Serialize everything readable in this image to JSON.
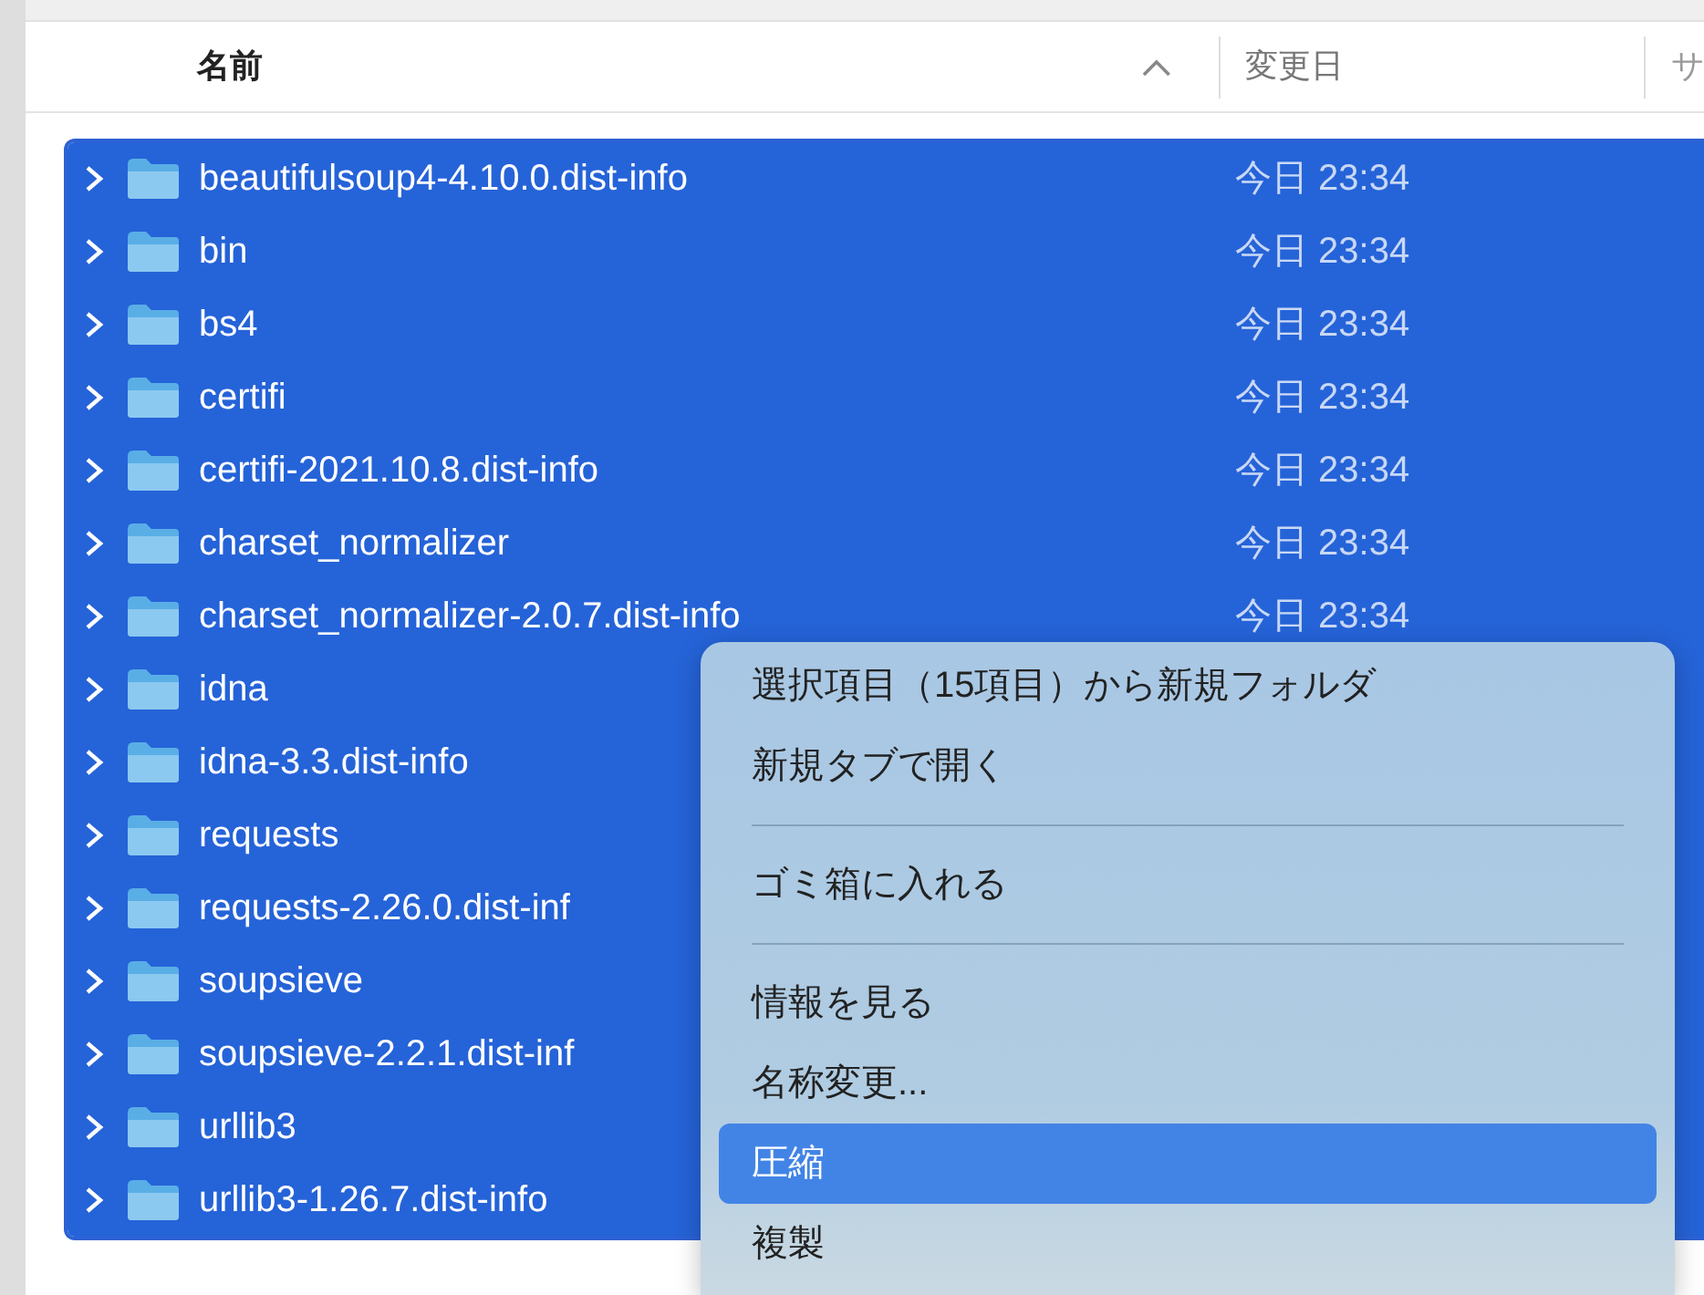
{
  "header": {
    "columns": [
      {
        "label": "名前",
        "sorted": true
      },
      {
        "label": "変更日",
        "sorted": false
      },
      {
        "label": "サ",
        "sorted": false
      }
    ]
  },
  "rows": [
    {
      "name": "beautifulsoup4-4.10.0.dist-info",
      "modified": "今日 23:34",
      "selected": true
    },
    {
      "name": "bin",
      "modified": "今日 23:34",
      "selected": true
    },
    {
      "name": "bs4",
      "modified": "今日 23:34",
      "selected": true
    },
    {
      "name": "certifi",
      "modified": "今日 23:34",
      "selected": true
    },
    {
      "name": "certifi-2021.10.8.dist-info",
      "modified": "今日 23:34",
      "selected": true
    },
    {
      "name": "charset_normalizer",
      "modified": "今日 23:34",
      "selected": true
    },
    {
      "name": "charset_normalizer-2.0.7.dist-info",
      "modified": "今日 23:34",
      "selected": true
    },
    {
      "name": "idna",
      "selected": true
    },
    {
      "name": "idna-3.3.dist-info",
      "selected": true
    },
    {
      "name": "requests",
      "selected": true
    },
    {
      "name": "requests-2.26.0.dist-inf",
      "selected": true
    },
    {
      "name": "soupsieve",
      "selected": true
    },
    {
      "name": "soupsieve-2.2.1.dist-inf",
      "selected": true
    },
    {
      "name": "urllib3",
      "selected": true
    },
    {
      "name": "urllib3-1.26.7.dist-info",
      "selected": true
    }
  ],
  "context_menu": {
    "items": [
      {
        "kind": "item",
        "label": "選択項目（15項目）から新規フォルダ",
        "highlighted": false
      },
      {
        "kind": "item",
        "label": "新規タブで開く",
        "highlighted": false
      },
      {
        "kind": "separator"
      },
      {
        "kind": "item",
        "label": "ゴミ箱に入れる",
        "highlighted": false
      },
      {
        "kind": "separator"
      },
      {
        "kind": "item",
        "label": "情報を見る",
        "highlighted": false
      },
      {
        "kind": "item",
        "label": "名称変更...",
        "highlighted": false
      },
      {
        "kind": "item",
        "label": "圧縮",
        "highlighted": true
      },
      {
        "kind": "item",
        "label": "複製",
        "highlighted": false
      }
    ]
  }
}
